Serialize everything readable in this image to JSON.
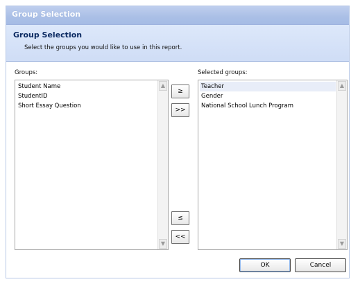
{
  "window": {
    "title": "Group Selection"
  },
  "header": {
    "title": "Group Selection",
    "subtitle": "Select the groups you would like to use in this report."
  },
  "available": {
    "label": "Groups:",
    "items": [
      "Student Name",
      "StudentID",
      "Short Essay Question"
    ]
  },
  "selected": {
    "label": "Selected groups:",
    "items": [
      "Teacher",
      "Gender",
      "National School Lunch Program"
    ],
    "highlighted_index": 0
  },
  "transfer_buttons": {
    "add_one": "≥",
    "add_all": ">>",
    "remove_one": "≤",
    "remove_all": "<<"
  },
  "footer": {
    "ok_label": "OK",
    "cancel_label": "Cancel"
  },
  "icons": {
    "scroll_up": "scroll-up-arrow",
    "scroll_down": "scroll-down-arrow"
  },
  "colors": {
    "title_bar": "#a6bce5",
    "header_band": "#cfddf6",
    "header_title": "#0b2a61",
    "selection_highlight": "#e8edf8"
  }
}
